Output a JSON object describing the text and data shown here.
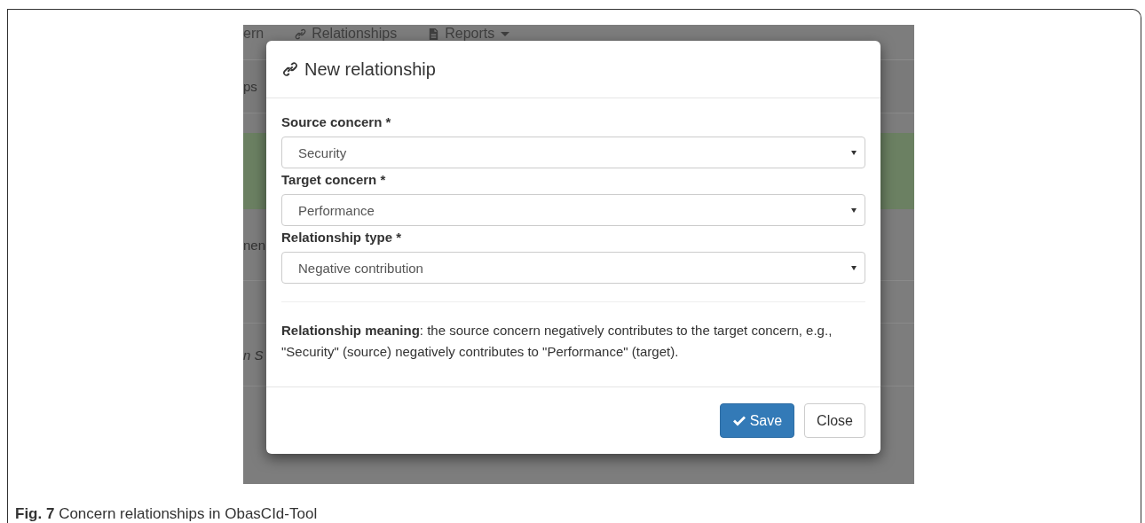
{
  "background": {
    "nav": [
      {
        "label": "ern",
        "kind": "plain"
      },
      {
        "label": "Relationships",
        "kind": "link"
      },
      {
        "label": "Reports",
        "kind": "menu"
      }
    ],
    "rows": [
      {
        "kind": "tab",
        "text": "ps"
      },
      {
        "kind": "banner"
      },
      {
        "kind": "item",
        "text": "nen"
      },
      {
        "kind": "blank"
      },
      {
        "kind": "note",
        "text": "n S"
      }
    ]
  },
  "modal": {
    "title": "New relationship",
    "fields": [
      {
        "label": "Source concern *",
        "value": "Security"
      },
      {
        "label": "Target concern *",
        "value": "Performance"
      },
      {
        "label": "Relationship type *",
        "value": "Negative contribution"
      }
    ],
    "meaning": "**Relationship meaning**: the source concern negatively contributes to the target concern, e.g., \"Security\" (source) negatively contributes to \"Performance\" (target).",
    "buttons": [
      {
        "label": "Save",
        "kind": "primary"
      },
      {
        "label": "Close",
        "kind": "default"
      }
    ]
  },
  "caption": "**Fig. 7** Concern relationships in ObasCId-Tool"
}
